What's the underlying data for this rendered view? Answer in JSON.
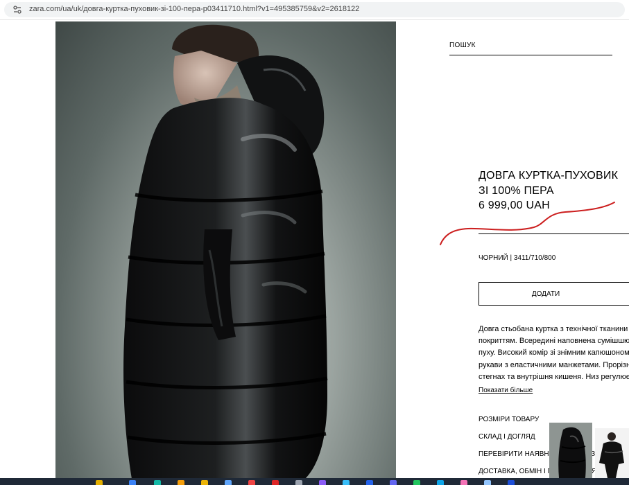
{
  "browser": {
    "url": "zara.com/ua/uk/довга-куртка-пуховик-зі-100-пера-p03411710.html?v1=495385759&v2=2618122"
  },
  "header": {
    "search_label": "ПОШУК"
  },
  "product": {
    "title": "ДОВГА КУРТКА-ПУХОВИК ЗІ 100% ПЕРА",
    "price": "6 999,00 UAH",
    "color_ref": "ЧОРНИЙ | 3411/710/800",
    "add_button": "ДОДАТИ",
    "description_lines": [
      "Довга стьобана куртка з технічної тканини з б",
      "покриттям. Всередині наповнена сумішшю пе",
      "пуху. Високий комір зі знімним капюшоном та",
      "рукави з еластичними манжетами. Прорізні к",
      "стегнах та внутрішня кишеня. Низ регулюєть"
    ],
    "show_more": "Показати більше",
    "accordion": [
      "РОЗМІРИ ТОВАРУ",
      "СКЛАД І ДОГЛЯД",
      "ПЕРЕВІРИТИ НАЯВНІСТЬ У МАГАЗИНІ",
      "ДОСТАВКА, ОБМІН І ПОВЕРНЕННЯ"
    ]
  },
  "colors": {
    "annotation": "#cc1f1f",
    "taskbar": "#1f2937"
  }
}
